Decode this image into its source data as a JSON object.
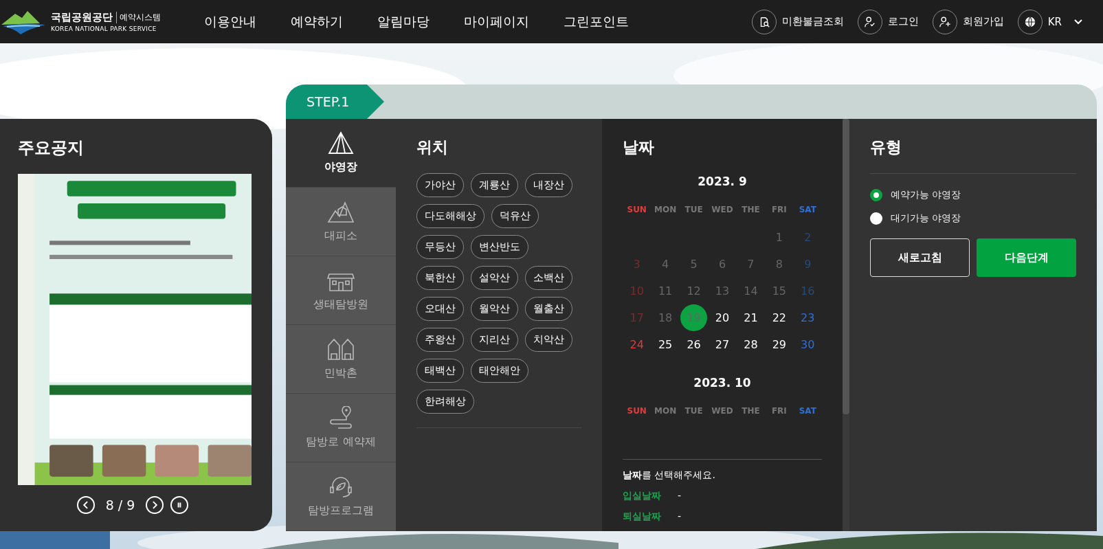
{
  "header": {
    "logo": {
      "name": "국립공원공단",
      "sub": "예약시스템",
      "english": "KOREA NATIONAL PARK SERVICE"
    },
    "nav": [
      "이용안내",
      "예약하기",
      "알림마당",
      "마이페이지",
      "그린포인트"
    ],
    "utilities": [
      {
        "kind": "fine",
        "label": "미환불금조회"
      },
      {
        "kind": "login",
        "label": "로그인"
      },
      {
        "kind": "join",
        "label": "회원가입"
      }
    ],
    "language": {
      "label": "KR"
    }
  },
  "notice": {
    "title": "주요공지",
    "pager": "8 / 9"
  },
  "step": {
    "label": "STEP.1"
  },
  "categories": [
    {
      "kind": "tent",
      "label": "야영장",
      "selected": true
    },
    {
      "kind": "shelter",
      "label": "대피소",
      "selected": false
    },
    {
      "kind": "eco",
      "label": "생태탐방원",
      "selected": false
    },
    {
      "kind": "village",
      "label": "민박촌",
      "selected": false
    },
    {
      "kind": "trail",
      "label": "탐방로 예약제",
      "selected": false
    },
    {
      "kind": "program",
      "label": "탐방프로그램",
      "selected": false
    }
  ],
  "location": {
    "title": "위치",
    "options": [
      "가야산",
      "계룡산",
      "내장산",
      "다도해해상",
      "덕유산",
      "무등산",
      "변산반도",
      "북한산",
      "설악산",
      "소백산",
      "오대산",
      "월악산",
      "월출산",
      "주왕산",
      "지리산",
      "치악산",
      "태백산",
      "태안해안",
      "한려해상"
    ]
  },
  "date": {
    "title": "날짜",
    "months": [
      {
        "title": "2023. 9",
        "weekdays": [
          "SUN",
          "MON",
          "TUE",
          "WED",
          "THE",
          "FRI",
          "SAT"
        ],
        "weeks": [
          [
            {
              "day": "1",
              "past": true,
              "selected": false
            },
            {
              "day": "2",
              "past": true,
              "selected": false
            }
          ],
          [
            {
              "day": "3",
              "past": true,
              "selected": false
            },
            {
              "day": "4",
              "past": true,
              "selected": false
            },
            {
              "day": "5",
              "past": true,
              "selected": false
            },
            {
              "day": "6",
              "past": true,
              "selected": false
            },
            {
              "day": "7",
              "past": true,
              "selected": false
            },
            {
              "day": "8",
              "past": true,
              "selected": false
            },
            {
              "day": "9",
              "past": true,
              "selected": false
            }
          ],
          [
            {
              "day": "10",
              "past": true,
              "selected": false
            },
            {
              "day": "11",
              "past": true,
              "selected": false
            },
            {
              "day": "12",
              "past": true,
              "selected": false
            },
            {
              "day": "13",
              "past": true,
              "selected": false
            },
            {
              "day": "14",
              "past": true,
              "selected": false
            },
            {
              "day": "15",
              "past": true,
              "selected": false
            },
            {
              "day": "16",
              "past": true,
              "selected": false
            }
          ],
          [
            {
              "day": "17",
              "past": true,
              "selected": false
            },
            {
              "day": "18",
              "past": true,
              "selected": false
            },
            {
              "day": "19",
              "past": true,
              "selected": true
            },
            {
              "day": "20",
              "past": false,
              "selected": false
            },
            {
              "day": "21",
              "past": false,
              "selected": false
            },
            {
              "day": "22",
              "past": false,
              "selected": false
            },
            {
              "day": "23",
              "past": false,
              "selected": false
            }
          ],
          [
            {
              "day": "24",
              "past": false,
              "selected": false
            },
            {
              "day": "25",
              "past": false,
              "selected": false
            },
            {
              "day": "26",
              "past": false,
              "selected": false
            },
            {
              "day": "27",
              "past": false,
              "selected": false
            },
            {
              "day": "28",
              "past": false,
              "selected": false
            },
            {
              "day": "29",
              "past": false,
              "selected": false
            },
            {
              "day": "30",
              "past": false,
              "selected": false
            }
          ]
        ]
      },
      {
        "title": "2023. 10",
        "weekdays": [
          "SUN",
          "MON",
          "TUE",
          "WED",
          "THE",
          "FRI",
          "SAT"
        ]
      }
    ],
    "prompt": "**날짜**를 선택해주세요.",
    "stay": [
      {
        "label": "입실날짜",
        "value": "-"
      },
      {
        "label": "퇴실날짜",
        "value": "-"
      }
    ]
  },
  "type": {
    "title": "유형",
    "options": [
      {
        "label": "예약가능 야영장",
        "selected": true
      },
      {
        "label": "대기가능 야영장",
        "selected": false
      }
    ],
    "buttons": [
      {
        "kind": "outline",
        "label": "새로고침"
      },
      {
        "kind": "primary",
        "label": "다음단계"
      }
    ]
  }
}
